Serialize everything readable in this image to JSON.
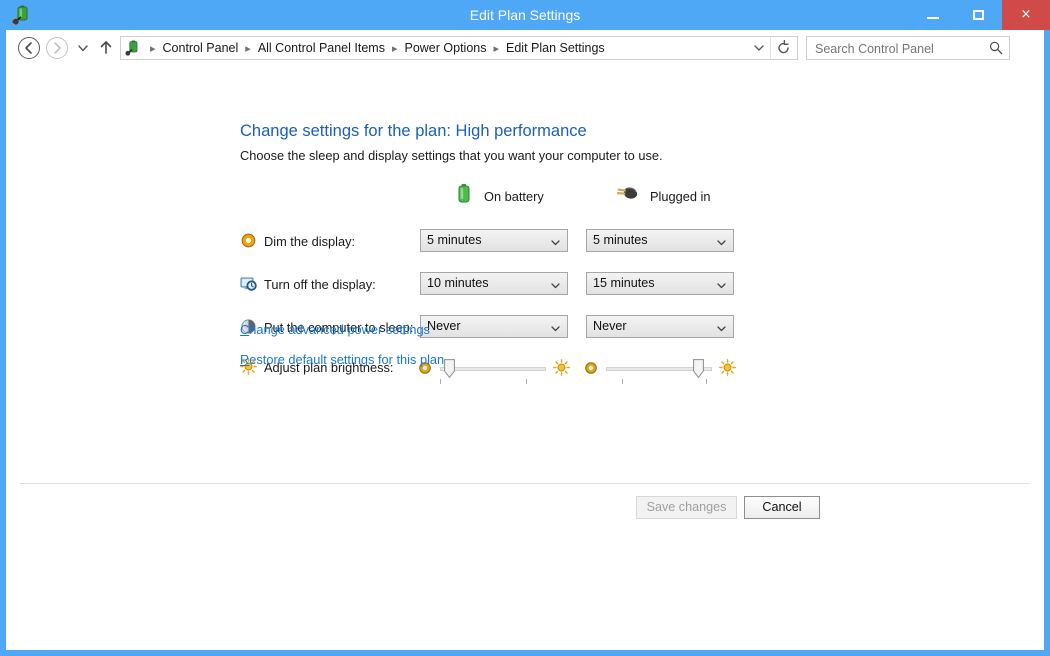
{
  "window": {
    "title": "Edit Plan Settings",
    "app_icon": "power-plan-icon",
    "controls": {
      "minimize": "minimize-button",
      "maximize": "maximize-button",
      "close_glyph": "×"
    },
    "border_color": "#4fa8f5",
    "close_color": "#d04a4a"
  },
  "nav": {
    "back": "Back",
    "forward": "Forward",
    "recent": "Recent locations",
    "up": "Up one level",
    "address_dropdown": "˅",
    "refresh": "⟳",
    "breadcrumbs": [
      {
        "label": "Control Panel"
      },
      {
        "label": "All Control Panel Items"
      },
      {
        "label": "Power Options"
      },
      {
        "label": "Edit Plan Settings"
      }
    ],
    "separator": "▸"
  },
  "search": {
    "placeholder": "Search Control Panel",
    "value": "",
    "icon": "search-icon"
  },
  "page": {
    "title": "Change settings for the plan: High performance",
    "subtitle": "Choose the sleep and display settings that you want your computer to use.",
    "title_color": "#1c5fb5"
  },
  "columns": [
    {
      "key": "battery",
      "label": "On battery",
      "icon": "battery-icon"
    },
    {
      "key": "plugged",
      "label": "Plugged in",
      "icon": "power-plug-icon"
    }
  ],
  "settings": [
    {
      "icon": "dim-display-icon",
      "label": "Dim the display:",
      "battery": "5 minutes",
      "plugged": "5 minutes"
    },
    {
      "icon": "turn-off-display-icon",
      "label": "Turn off the display:",
      "battery": "10 minutes",
      "plugged": "15 minutes"
    },
    {
      "icon": "sleep-icon",
      "label": "Put the computer to sleep:",
      "battery": "Never",
      "plugged": "Never"
    }
  ],
  "brightness": {
    "icon": "brightness-icon",
    "label": "Adjust plan brightness:",
    "low_icon": "low-brightness-icon",
    "high_icon": "high-brightness-icon",
    "battery_percent": 4,
    "plugged_percent": 92
  },
  "links": [
    {
      "key": "advanced",
      "first": "C",
      "rest": "hange advanced power settings"
    },
    {
      "key": "restore",
      "first": "R",
      "rest": "estore default settings for this plan"
    }
  ],
  "buttons": {
    "save": {
      "label": "Save changes",
      "enabled": false
    },
    "cancel": {
      "label": "Cancel",
      "enabled": true
    }
  }
}
